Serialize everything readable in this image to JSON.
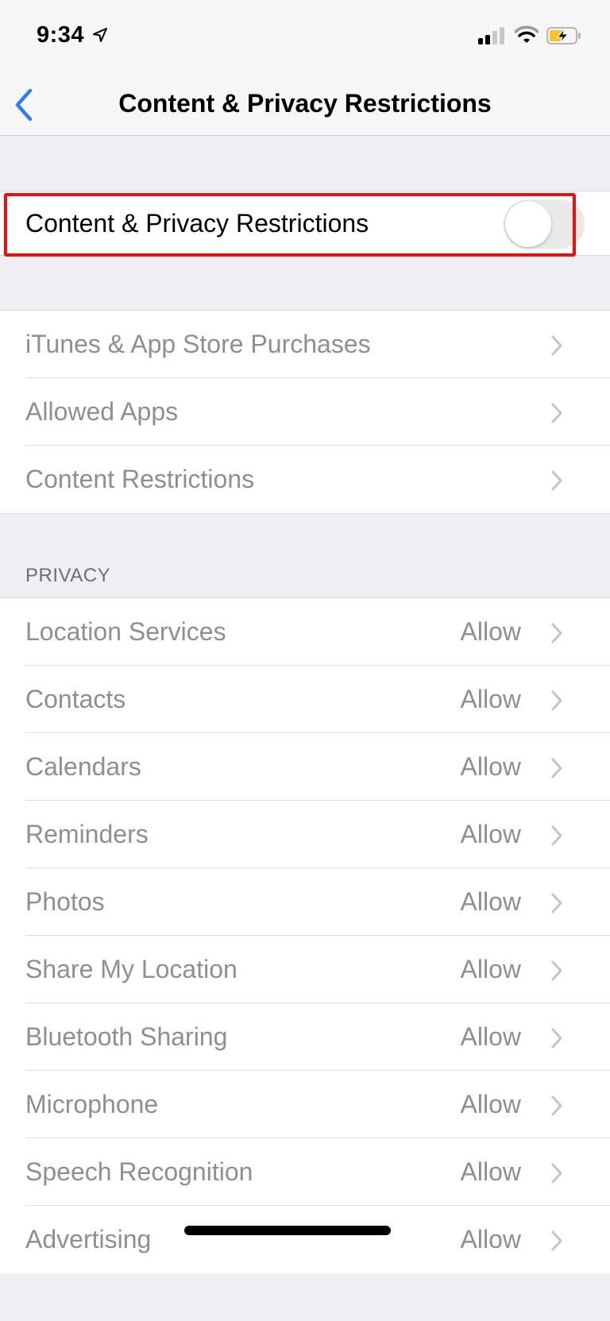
{
  "status_bar": {
    "time": "9:34",
    "location_icon": "location-arrow-icon",
    "signal_icon": "cellular-signal-icon",
    "signal_bars_active": 2,
    "signal_bars_total": 4,
    "wifi_icon": "wifi-icon",
    "battery_icon": "battery-charging-icon",
    "battery_level_fraction": 0.45,
    "battery_color": "#f4c430"
  },
  "nav": {
    "back_icon": "chevron-left-icon",
    "title": "Content & Privacy Restrictions",
    "accent_color": "#2f7cf6"
  },
  "master_toggle": {
    "label": "Content & Privacy Restrictions",
    "on": false,
    "highlight_color": "#f10d0c"
  },
  "restrictions_group": {
    "items": [
      {
        "label": "iTunes & App Store Purchases"
      },
      {
        "label": "Allowed Apps"
      },
      {
        "label": "Content Restrictions"
      }
    ]
  },
  "privacy": {
    "header": "PRIVACY",
    "items": [
      {
        "label": "Location Services",
        "value": "Allow"
      },
      {
        "label": "Contacts",
        "value": "Allow"
      },
      {
        "label": "Calendars",
        "value": "Allow"
      },
      {
        "label": "Reminders",
        "value": "Allow"
      },
      {
        "label": "Photos",
        "value": "Allow"
      },
      {
        "label": "Share My Location",
        "value": "Allow"
      },
      {
        "label": "Bluetooth Sharing",
        "value": "Allow"
      },
      {
        "label": "Microphone",
        "value": "Allow"
      },
      {
        "label": "Speech Recognition",
        "value": "Allow"
      },
      {
        "label": "Advertising",
        "value": "Allow"
      }
    ]
  }
}
